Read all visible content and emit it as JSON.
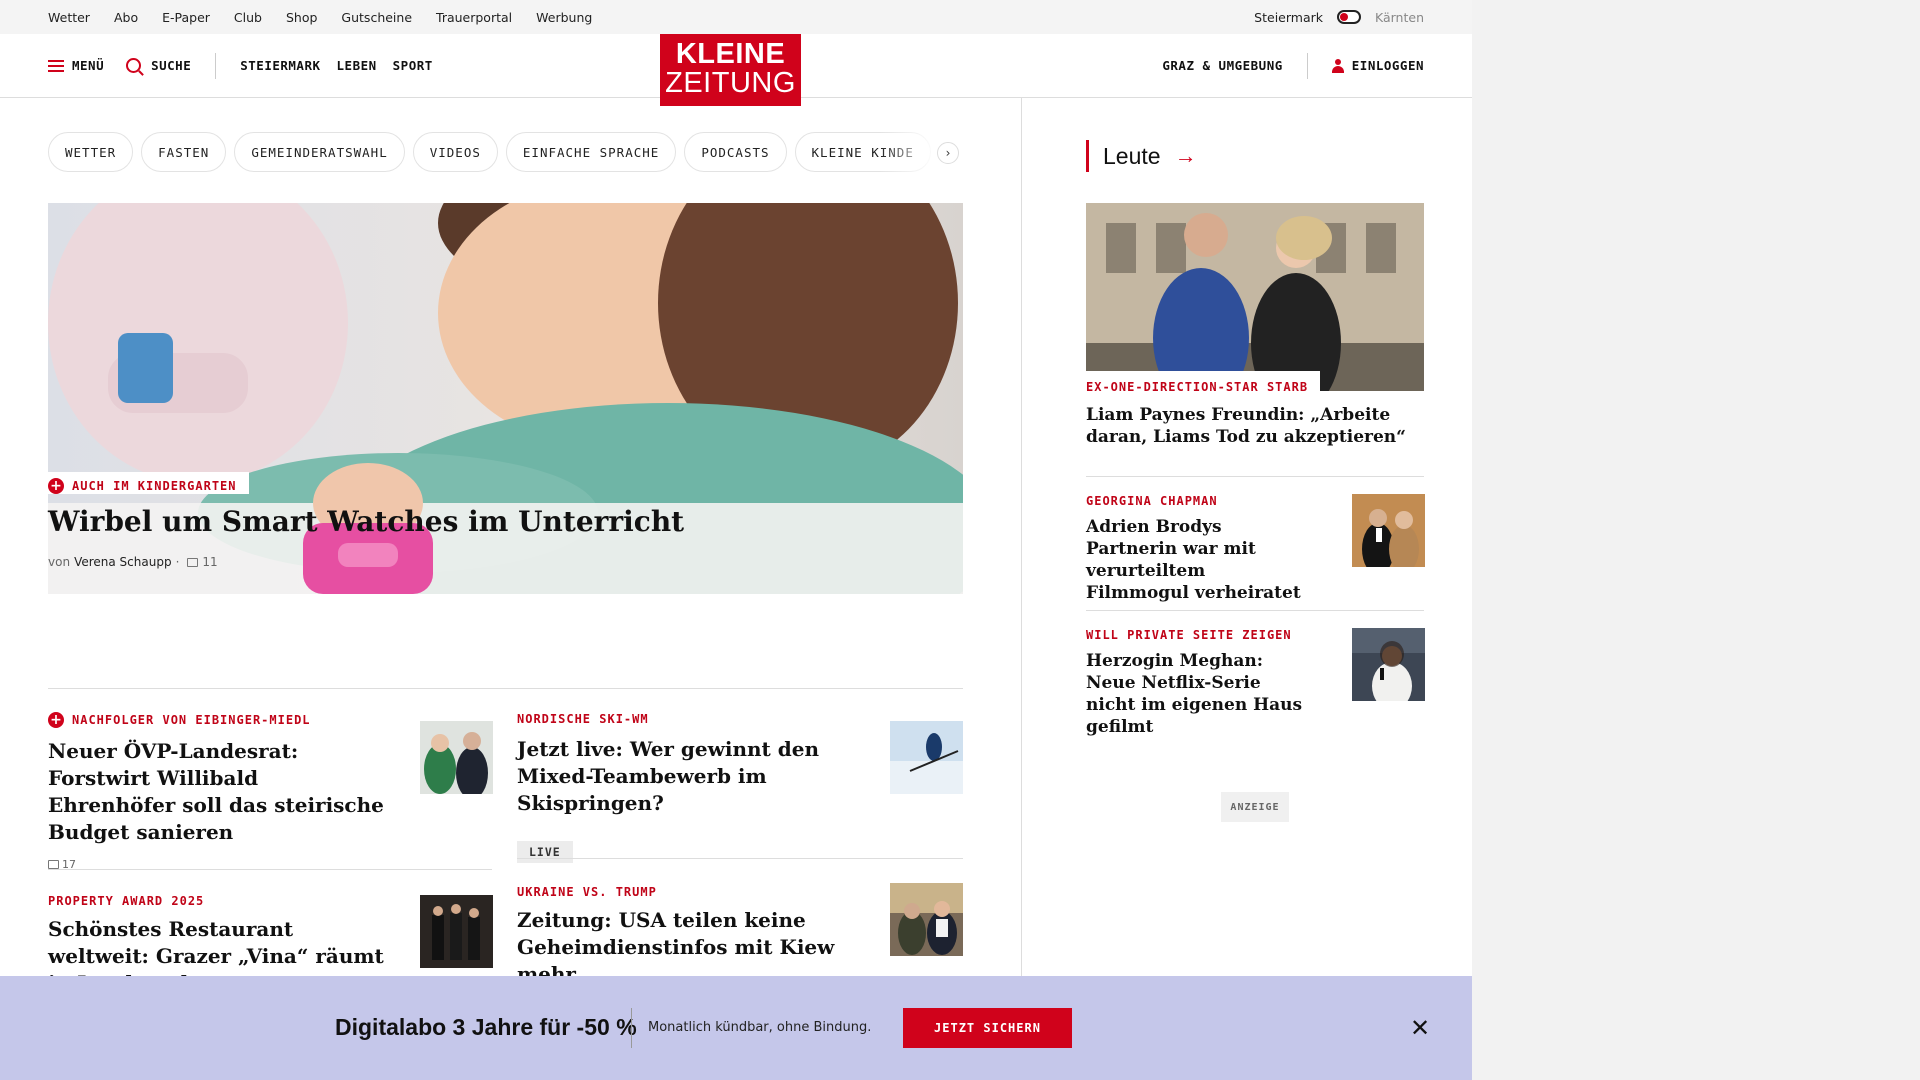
{
  "topbar": {
    "links": [
      "Wetter",
      "Abo",
      "E-Paper",
      "Club",
      "Shop",
      "Gutscheine",
      "Trauerportal",
      "Werbung"
    ],
    "region_active": "Steiermark",
    "region_other": "Kärnten"
  },
  "header": {
    "menu_label": "MENÜ",
    "search_label": "SUCHE",
    "nav": [
      "STEIERMARK",
      "LEBEN",
      "SPORT"
    ],
    "logo_line1": "KLEINE",
    "logo_line2": "ZEITUNG",
    "region_link": "GRAZ & UMGEBUNG",
    "login_label": "EINLOGGEN"
  },
  "chips": [
    "WETTER",
    "FASTEN",
    "GEMEINDERATSWAHL",
    "VIDEOS",
    "EINFACHE SPRACHE",
    "PODCASTS",
    "KLEINE KINDE"
  ],
  "hero": {
    "kicker": "AUCH IM KINDERGARTEN",
    "title": "Wirbel um Smart Watches im Unterricht",
    "by_prefix": "von",
    "author": "Verena Schaupp",
    "sep": "·",
    "comments": "11"
  },
  "articles": {
    "a1": {
      "kicker": "NACHFOLGER VON EIBINGER-MIEDL",
      "title": "Neuer ÖVP-Landesrat: Forstwirt Willibald Ehrenhöfer soll das steirische Budget sanieren",
      "comments": "17"
    },
    "a2": {
      "kicker": "NORDISCHE SKI-WM",
      "title": "Jetzt live: Wer gewinnt den Mixed-Teambewerb im Skispringen?",
      "badge": "LIVE"
    },
    "a3": {
      "kicker": "PROPERTY AWARD 2025",
      "title": "Schönstes Restaurant weltweit: Grazer „Vina“ räumt in London ab"
    },
    "a4": {
      "kicker": "UKRAINE VS. TRUMP",
      "title": "Zeitung: USA teilen keine Geheimdienstinfos mit Kiew mehr"
    }
  },
  "right": {
    "section_title": "Leute",
    "big": {
      "kicker": "EX-ONE-DIRECTION-STAR STARB",
      "title": "Liam Paynes Freundin: „Arbeite daran, Liams Tod zu akzeptieren“"
    },
    "items": [
      {
        "kicker": "GEORGINA CHAPMAN",
        "title": "Adrien Brodys Partnerin war mit verurteiltem Filmmogul verheiratet"
      },
      {
        "kicker": "WILL PRIVATE SEITE ZEIGEN",
        "title": "Herzogin Meghan: Neue Netflix-Serie nicht im eigenen Haus gefilmt"
      }
    ],
    "ad_label": "ANZEIGE"
  },
  "promo": {
    "title": "Digitalabo 3 Jahre für -50 %",
    "subtitle": "Monatlich kündbar, ohne Bindung.",
    "button": "JETZT SICHERN"
  },
  "colors": {
    "brand": "#d0021b",
    "promo_bg": "#c5c7ea"
  }
}
